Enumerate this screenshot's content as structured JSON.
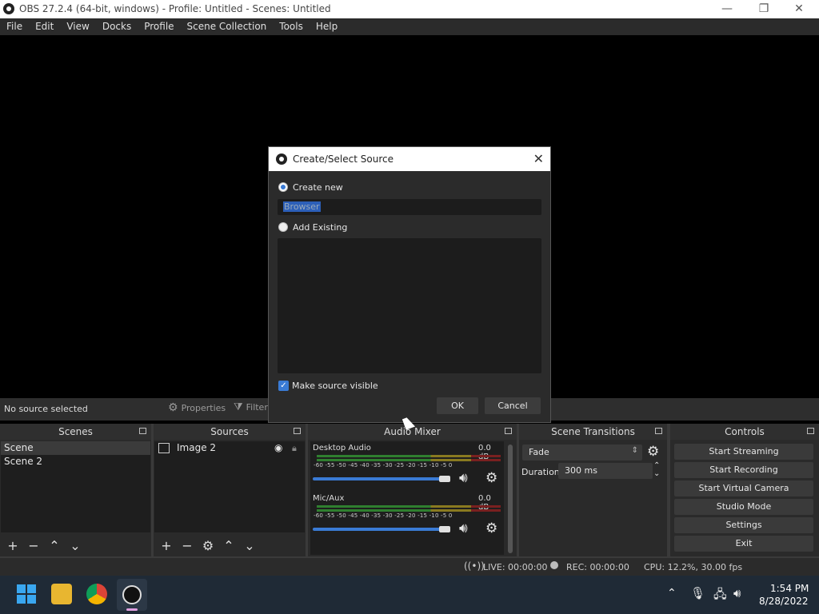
{
  "window": {
    "title": "OBS 27.2.4 (64-bit, windows) - Profile: Untitled - Scenes: Untitled",
    "minimize": "—",
    "restore": "❐",
    "close": "✕"
  },
  "menubar": [
    "File",
    "Edit",
    "View",
    "Docks",
    "Profile",
    "Scene Collection",
    "Tools",
    "Help"
  ],
  "contextbar": {
    "no_source": "No source selected",
    "properties": "Properties",
    "filters": "Filters"
  },
  "docks": {
    "scenes": {
      "title": "Scenes",
      "items": [
        "Scene",
        "Scene 2"
      ]
    },
    "sources": {
      "title": "Sources",
      "items": [
        "Image 2"
      ]
    },
    "mixer": {
      "title": "Audio Mixer",
      "channels": [
        {
          "name": "Desktop Audio",
          "db": "0.0 dB"
        },
        {
          "name": "Mic/Aux",
          "db": "0.0 dB"
        }
      ],
      "scale": "-60 -55 -50 -45 -40 -35 -30 -25 -20 -15 -10 -5 0",
      "volume": 0.93
    },
    "transitions": {
      "title": "Scene Transitions",
      "selected": "Fade",
      "duration_label": "Duration",
      "duration_value": "300 ms"
    },
    "controls": {
      "title": "Controls",
      "buttons": [
        "Start Streaming",
        "Start Recording",
        "Start Virtual Camera",
        "Studio Mode",
        "Settings",
        "Exit"
      ]
    }
  },
  "statusbar": {
    "live": "LIVE: 00:00:00",
    "rec": "REC: 00:00:00",
    "cpu": "CPU: 12.2%, 30.00 fps"
  },
  "taskbar": {
    "time": "1:54 PM",
    "date": "8/28/2022"
  },
  "dialog": {
    "title": "Create/Select Source",
    "create_new": "Create new",
    "name_value": "Browser",
    "add_existing": "Add Existing",
    "make_visible": "Make source visible",
    "ok": "OK",
    "cancel": "Cancel",
    "close": "✕"
  },
  "colors": {
    "accent": "#3a7bd5",
    "panel": "#2a2a2a",
    "background": "#000000"
  }
}
